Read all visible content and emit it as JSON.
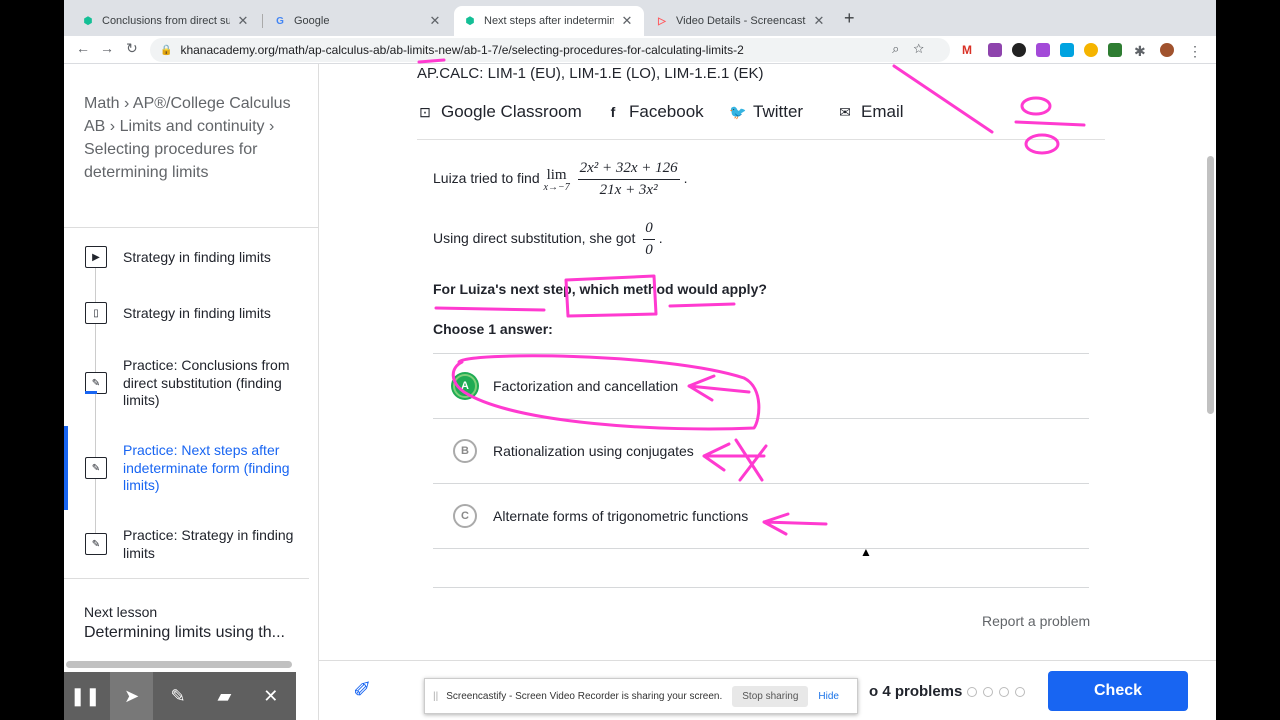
{
  "browser": {
    "tabs": [
      {
        "title": "Conclusions from direct substit",
        "icon": "khan-academy-icon",
        "active": false
      },
      {
        "title": "Google",
        "icon": "google-icon",
        "active": false
      },
      {
        "title": "Next steps after indeterminate",
        "icon": "khan-academy-icon",
        "active": true
      },
      {
        "title": "Video Details - Screencastify",
        "icon": "screencastify-icon",
        "active": false
      }
    ],
    "url": "khanacademy.org/math/ap-calculus-ab/ab-limits-new/ab-1-7/e/selecting-procedures-for-calculating-limits-2"
  },
  "sidebar": {
    "breadcrumb": [
      "Math",
      "AP®/College Calculus AB",
      "Limits and continuity",
      "Selecting procedures for determining limits"
    ],
    "sep": "›",
    "items": [
      {
        "label": "Strategy in finding limits",
        "icon": "play-icon",
        "glyph": "▶"
      },
      {
        "label": "Strategy in finding limits",
        "icon": "article-icon",
        "glyph": "▯"
      },
      {
        "label": "Practice: Conclusions from direct substitution (finding limits)",
        "icon": "pencil-icon",
        "glyph": "✎"
      },
      {
        "label": "Practice: Next steps after indeterminate form (finding limits)",
        "icon": "pencil-icon",
        "glyph": "✎",
        "current": true
      },
      {
        "label": "Practice: Strategy in finding limits",
        "icon": "pencil-icon",
        "glyph": "✎"
      }
    ],
    "next_lesson_label": "Next lesson",
    "next_lesson_title": "Determining limits using th..."
  },
  "main": {
    "standards": "AP.CALC: LIM-1 (EU), LIM-1.E (LO), LIM-1.E.1 (EK)",
    "share": [
      {
        "label": "Google Classroom",
        "icon": "google-classroom-icon",
        "glyph": "⊡"
      },
      {
        "label": "Facebook",
        "icon": "facebook-icon",
        "glyph": "f"
      },
      {
        "label": "Twitter",
        "icon": "twitter-icon",
        "glyph": "🐦"
      },
      {
        "label": "Email",
        "icon": "email-icon",
        "glyph": "✉"
      }
    ],
    "question": {
      "intro": "Luiza tried to find",
      "lim_word": "lim",
      "lim_sub": "x→−7",
      "numerator": "2x² + 32x + 126",
      "denominator": "21x + 3x²",
      "period": ".",
      "direct_text": "Using direct substitution, she got",
      "zero_num": "0",
      "zero_den": "0",
      "prompt": "For Luiza's next step, which method would apply?",
      "choose": "Choose 1 answer:"
    },
    "options": [
      {
        "letter": "A",
        "text": "Factorization and cancellation",
        "selected": true
      },
      {
        "letter": "B",
        "text": "Rationalization using conjugates",
        "selected": false
      },
      {
        "letter": "C",
        "text": "Alternate forms of trigonometric functions",
        "selected": false
      }
    ],
    "report": "Report a problem"
  },
  "bottom": {
    "progress_text": "o 4 problems",
    "check_label": "Check"
  },
  "banner": {
    "text": "Screencastify - Screen Video Recorder is sharing your screen.",
    "stop": "Stop sharing",
    "hide": "Hide"
  },
  "annotation_tools": [
    {
      "name": "pause-icon",
      "glyph": "❚❚"
    },
    {
      "name": "cursor-icon",
      "glyph": "➤",
      "active": true
    },
    {
      "name": "pen-icon",
      "glyph": "✎"
    },
    {
      "name": "highlighter-icon",
      "glyph": "▰"
    },
    {
      "name": "close-icon",
      "glyph": "✕"
    }
  ],
  "colors": {
    "ink": "#ff3ad0",
    "accent": "#1865f2",
    "correct": "#1fab54"
  }
}
